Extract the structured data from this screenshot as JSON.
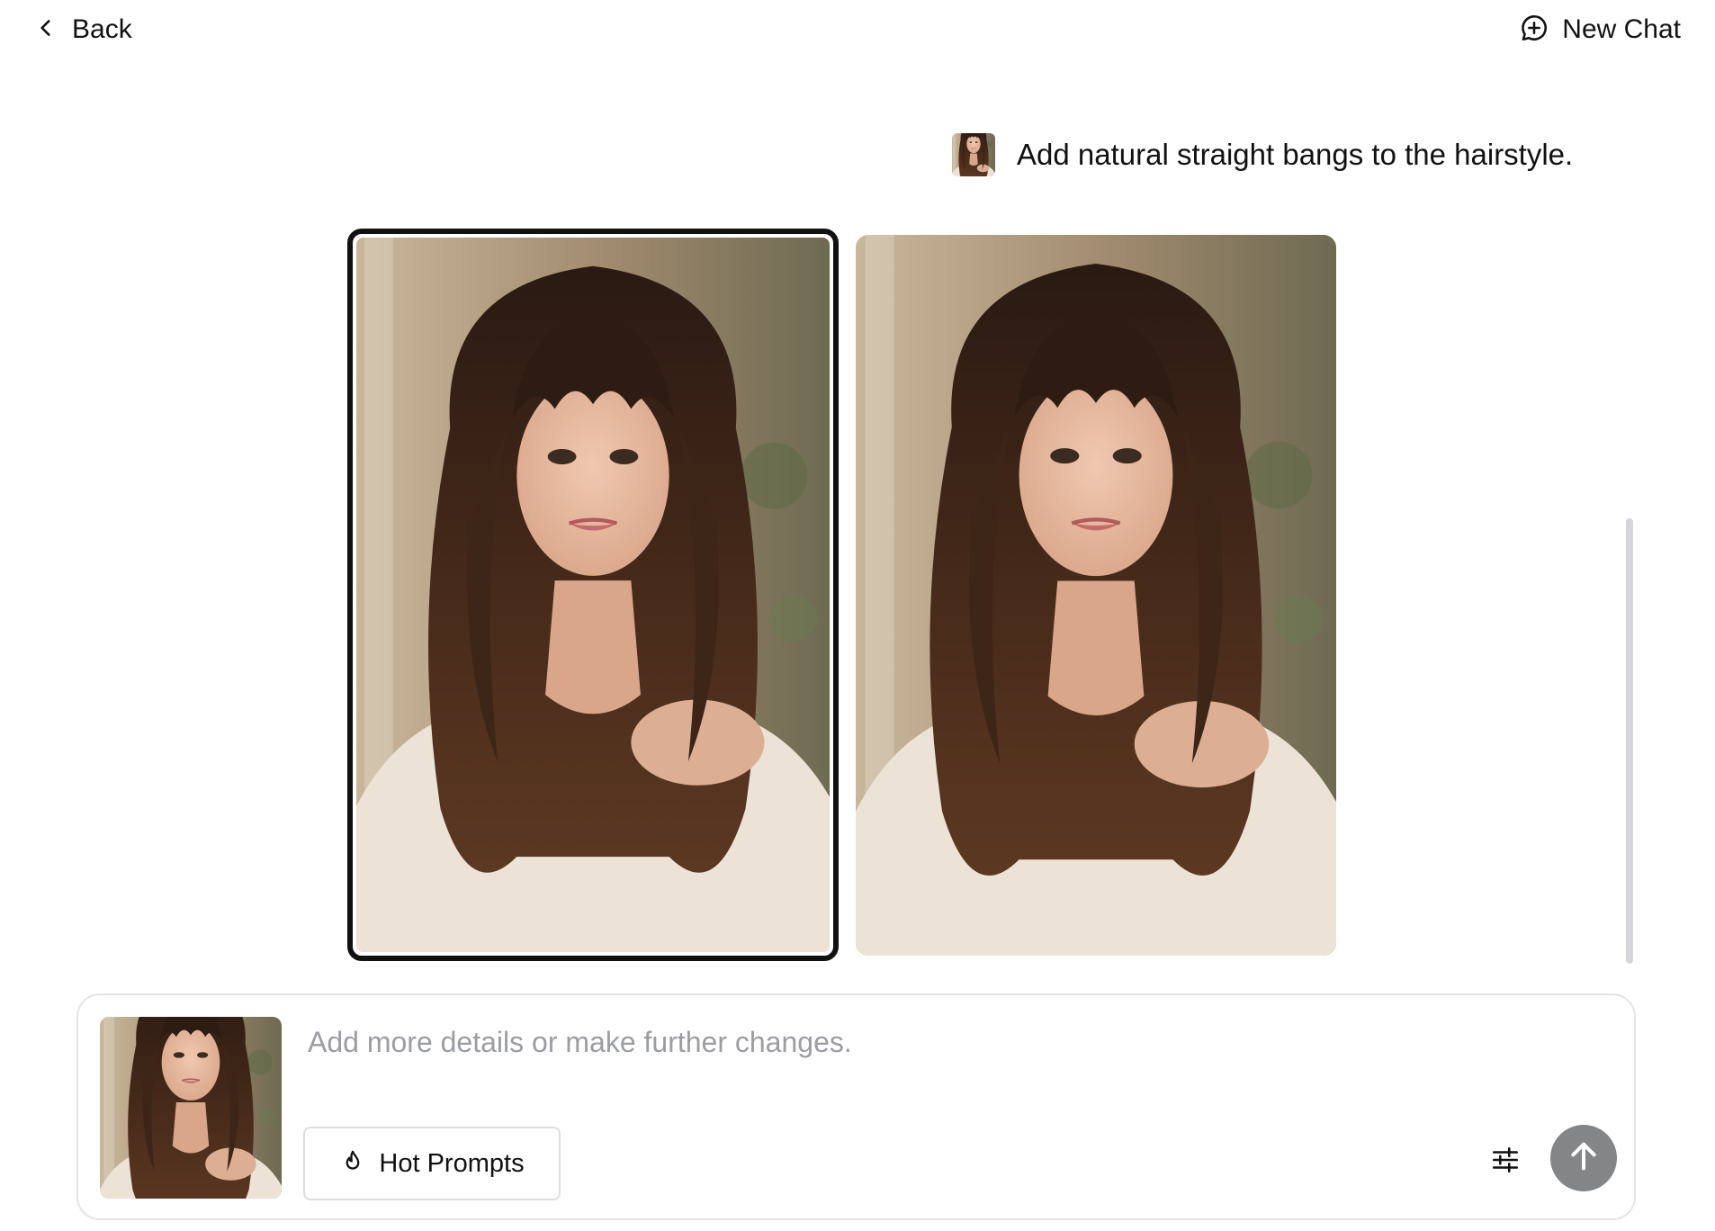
{
  "header": {
    "back_label": "Back",
    "back_icon": "chevron-left-icon",
    "new_chat_label": "New Chat",
    "new_chat_icon": "chat-plus-icon"
  },
  "conversation": {
    "user_message": "Add natural straight bangs to the hairstyle.",
    "results": [
      {
        "selected": true
      },
      {
        "selected": false
      }
    ]
  },
  "composer": {
    "placeholder": "Add more details or make further changes.",
    "value": "",
    "hot_prompts_label": "Hot Prompts",
    "hot_prompts_icon": "flame-icon",
    "settings_icon": "sliders-icon",
    "send_icon": "arrow-up-icon"
  },
  "colors": {
    "send_button": "#848587",
    "selected_border": "#111111",
    "placeholder_text": "#9b9da2",
    "hair": "#3a2417",
    "skin": "#e6b9a0",
    "sweater": "#ece3d6",
    "background": "#a99478"
  }
}
